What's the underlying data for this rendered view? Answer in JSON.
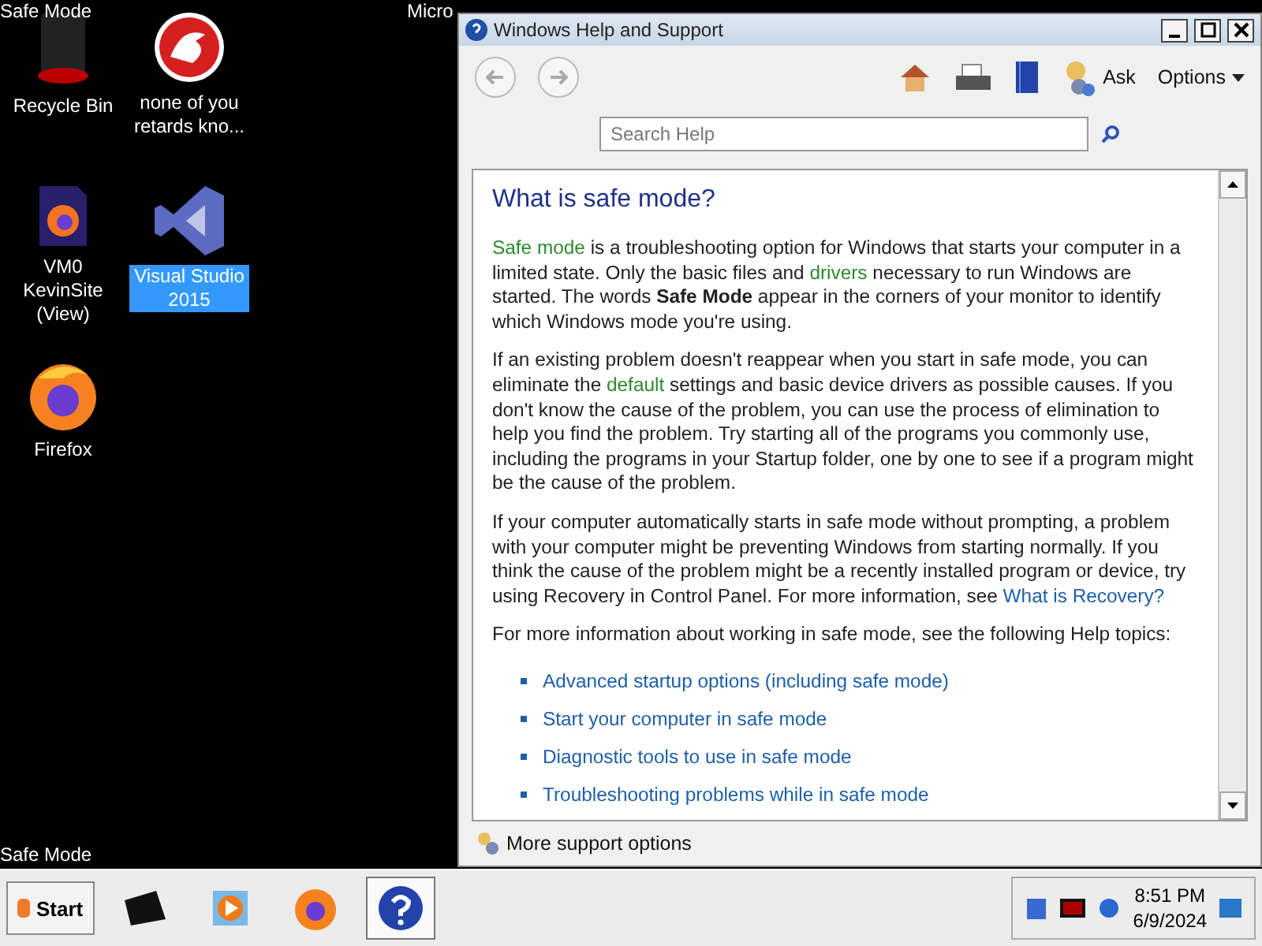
{
  "desktop": {
    "corner_top": "Safe Mode",
    "corner_bottom": "Safe Mode",
    "behind_title": "Micro",
    "icons": [
      {
        "label": "Recycle Bin",
        "kind": "bin",
        "selected": false
      },
      {
        "label": "none of you retards kno...",
        "kind": "dragon",
        "selected": false
      },
      {
        "label": "VM0 KevinSite (View)",
        "kind": "file",
        "selected": false
      },
      {
        "label": "Visual Studio 2015",
        "kind": "vs",
        "selected": true
      },
      {
        "label": "Firefox",
        "kind": "firefox",
        "selected": false
      }
    ]
  },
  "window": {
    "title": "Windows Help and Support",
    "toolbar": {
      "ask": "Ask",
      "options": "Options"
    },
    "search": {
      "placeholder": "Search Help"
    },
    "heading": "What is safe mode?",
    "paragraphs": [
      [
        {
          "kind": "link",
          "text": "Safe mode"
        },
        {
          "kind": "plain",
          "text": " is a troubleshooting option for Windows that starts your computer in a limited state. Only the basic files and "
        },
        {
          "kind": "link",
          "text": "drivers"
        },
        {
          "kind": "plain",
          "text": " necessary to run Windows are started. The words "
        },
        {
          "kind": "bold",
          "text": "Safe Mode"
        },
        {
          "kind": "plain",
          "text": " appear in the corners of your monitor to identify which Windows mode you're using."
        }
      ],
      [
        {
          "kind": "plain",
          "text": "If an existing problem doesn't reappear when you start in safe mode, you can eliminate the "
        },
        {
          "kind": "link",
          "text": "default"
        },
        {
          "kind": "plain",
          "text": " settings and basic device drivers as possible causes. If you don't know the cause of the problem, you can use the process of elimination to help you find the problem. Try starting all of the programs you commonly use, including the programs in your Startup folder, one by one to see if a program might be the cause of the problem."
        }
      ],
      [
        {
          "kind": "plain",
          "text": "If your computer automatically starts in safe mode without prompting, a problem with your computer might be preventing Windows from starting normally. If you think the cause of the problem might be a recently installed program or device, try using Recovery in Control Panel. For more information, see "
        },
        {
          "kind": "topic",
          "text": "What is Recovery?"
        }
      ],
      [
        {
          "kind": "plain",
          "text": "For more information about working in safe mode, see the following Help topics:"
        }
      ]
    ],
    "topics": [
      "Advanced startup options (including safe mode)",
      "Start your computer in safe mode",
      "Diagnostic tools to use in safe mode",
      "Troubleshooting problems while in safe mode"
    ],
    "footer": "More support options"
  },
  "taskbar": {
    "start": "Start",
    "time": "8:51 PM",
    "date": "6/9/2024"
  }
}
